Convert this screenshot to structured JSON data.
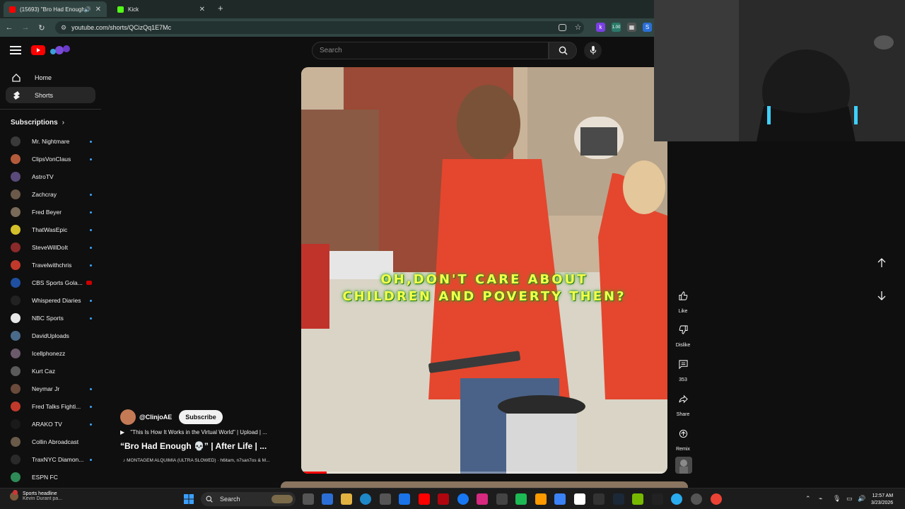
{
  "browser": {
    "tabs": [
      {
        "title": "(15693) \"Bro Had Enough",
        "favicon_color": "#ff0000",
        "active": true
      },
      {
        "title": "Kick",
        "favicon_color": "#53fc18",
        "active": false
      }
    ],
    "url": "youtube.com/shorts/QCizQq1E7Mc"
  },
  "youtube": {
    "search_placeholder": "Search",
    "nav": [
      {
        "label": "Home",
        "icon": "home-icon"
      },
      {
        "label": "Shorts",
        "icon": "shorts-icon",
        "active": true
      }
    ],
    "subscriptions_label": "Subscriptions",
    "subscriptions": [
      {
        "name": "Mr. Nightmare",
        "color": "#3a3a3a",
        "dot": true
      },
      {
        "name": "ClipsVonClaus",
        "color": "#b35b3b",
        "dot": true
      },
      {
        "name": "AstroTV",
        "color": "#5a4a7a",
        "dot": false
      },
      {
        "name": "Zachcray",
        "color": "#6b5a4a",
        "dot": true
      },
      {
        "name": "Fred Beyer",
        "color": "#7a6a5a",
        "dot": true
      },
      {
        "name": "ThatWasEpic",
        "color": "#d4c02a",
        "dot": true
      },
      {
        "name": "SteveWillDoIt",
        "color": "#8a2a2a",
        "dot": true
      },
      {
        "name": "Travelwithchris",
        "color": "#c0392b",
        "dot": true
      },
      {
        "name": "CBS Sports Gola...",
        "color": "#1f4fa0",
        "dot": false,
        "live": true
      },
      {
        "name": "Whispered Diaries",
        "color": "#222222",
        "dot": true
      },
      {
        "name": "NBC Sports",
        "color": "#e8e8e8",
        "dot": true
      },
      {
        "name": "DavidUploads",
        "color": "#4a6a8a",
        "dot": false
      },
      {
        "name": "Icellphonezz",
        "color": "#6a5a6a",
        "dot": false
      },
      {
        "name": "Kurt Caz",
        "color": "#5a5a5a",
        "dot": false
      },
      {
        "name": "Neymar Jr",
        "color": "#6a4a3a",
        "dot": true
      },
      {
        "name": "Fred Talks Fighti...",
        "color": "#c0392b",
        "dot": true
      },
      {
        "name": "ARAKO TV",
        "color": "#1a1a1a",
        "dot": true
      },
      {
        "name": "Collin Abroadcast",
        "color": "#6a5a4a",
        "dot": false
      },
      {
        "name": "TraxNYC Diamon...",
        "color": "#2a2a2a",
        "dot": true
      },
      {
        "name": "ESPN FC",
        "color": "#2e8b57",
        "dot": false
      }
    ]
  },
  "short": {
    "caption_line1": "OH,DON'T CARE ABOUT",
    "caption_line2": "CHILDREN AND POVERTY THEN?",
    "progress": 0.07,
    "channel": "@ClinjoAE",
    "subscribe_label": "Subscribe",
    "playlist": "\"This Is How It Works in the Virtual World\" | Upload | ...",
    "title": "“Bro Had Enough 💀” | After Life | ...",
    "music": "MONTAGEM ALQUIMIA (ULTRA SLOWED) · h6itam, n7san7os & M...",
    "actions": [
      {
        "label": "Like",
        "icon": "thumbs-up-icon"
      },
      {
        "label": "Dislike",
        "icon": "thumbs-down-icon"
      },
      {
        "label": "353",
        "icon": "comment-icon"
      },
      {
        "label": "Share",
        "icon": "share-icon"
      },
      {
        "label": "Remix",
        "icon": "remix-icon"
      }
    ]
  },
  "taskbar": {
    "news_title": "Sports headline",
    "news_sub": "Kevin Durant pa...",
    "search": "Search",
    "time": "12:57 AM",
    "date": "3/23/2026"
  }
}
